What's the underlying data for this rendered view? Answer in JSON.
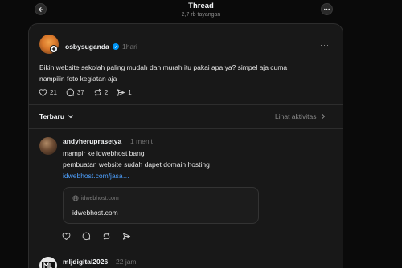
{
  "header": {
    "title": "Thread",
    "views": "2,7 rb tayangan"
  },
  "post": {
    "username": "osbysuganda",
    "time": "1hari",
    "text_line1": "Bikin website sekolah paling mudah dan murah itu pakai apa ya? simpel aja cuma",
    "text_line2": "nampilin foto kegiatan aja",
    "likes": "21",
    "comments": "37",
    "reposts": "2",
    "shares": "1"
  },
  "sort": {
    "label": "Terbaru",
    "activity_label": "Lihat aktivitas"
  },
  "replies": [
    {
      "username": "andyheruprasetya",
      "time": "1 menit",
      "line1": "mampir ke idwebhost bang",
      "line2": "pembuatan website sudah dapet domain hosting",
      "link_text": "idwebhost.com/jasa…",
      "card": {
        "domain": "idwebhost.com",
        "title": "idwebhost.com"
      }
    },
    {
      "username": "mljdigital2026",
      "time": "22 jam"
    }
  ],
  "colors": {
    "background": "#0a0a0a",
    "panel": "#181818",
    "link": "#4ea1ff",
    "verified": "#0095f6"
  }
}
